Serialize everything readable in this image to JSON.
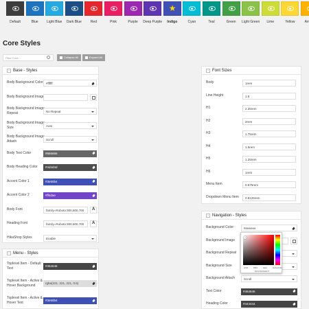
{
  "swatches": [
    {
      "name": "Default",
      "color": "#3d3d3d",
      "icon": "eye-icon"
    },
    {
      "name": "Blue",
      "color": "#1e73be",
      "icon": "eye-icon"
    },
    {
      "name": "Light Blue",
      "color": "#25a9e0",
      "icon": "eye-icon"
    },
    {
      "name": "Dark Blue",
      "color": "#1b4e84",
      "icon": "eye-icon"
    },
    {
      "name": "Red",
      "color": "#e5262d",
      "icon": "eye-icon"
    },
    {
      "name": "Pink",
      "color": "#e91e63",
      "icon": "eye-icon"
    },
    {
      "name": "Purple",
      "color": "#9c27b0",
      "icon": "eye-icon"
    },
    {
      "name": "Deep Purple",
      "color": "#5e35b1",
      "icon": "eye-icon"
    },
    {
      "name": "Indigo",
      "color": "#3f51b5",
      "icon": "star-icon",
      "active": true
    },
    {
      "name": "Cyan",
      "color": "#00bcd4",
      "icon": "eye-icon"
    },
    {
      "name": "Teal",
      "color": "#009688",
      "icon": "eye-icon"
    },
    {
      "name": "Green",
      "color": "#43a047",
      "icon": "eye-icon"
    },
    {
      "name": "Light Green",
      "color": "#8bc34a",
      "icon": "eye-icon"
    },
    {
      "name": "Lime",
      "color": "#cddc39",
      "icon": "eye-icon"
    },
    {
      "name": "Yellow",
      "color": "#fdd835",
      "icon": "eye-icon"
    },
    {
      "name": "Amber",
      "color": "#ffb300",
      "icon": "eye-icon"
    }
  ],
  "page_title": "Core Styles",
  "filter": {
    "placeholder": "Filter Core...",
    "collapse_label": "Collapse All",
    "expand_label": "Expand All"
  },
  "base": {
    "title": "Base - Styles",
    "rows": [
      {
        "label": "Body Background Color",
        "type": "color",
        "value": "#ffffff"
      },
      {
        "label": "Body Background Image",
        "type": "image",
        "value": ""
      },
      {
        "label": "Body Background Image Repeat",
        "type": "select",
        "value": "No Repeat"
      },
      {
        "label": "Body Background Image Size",
        "type": "select",
        "value": "Auto"
      },
      {
        "label": "Body Background Image Attach",
        "type": "select",
        "value": "Scroll"
      },
      {
        "label": "Body Text Color",
        "type": "color",
        "value": "#666666",
        "bg": "#666666"
      },
      {
        "label": "Body Heading Color",
        "type": "color",
        "value": "#4d4d4d",
        "bg": "#4d4d4d"
      },
      {
        "label": "Accent Color 1",
        "type": "color",
        "value": "#3e50b4",
        "bg": "#3e50b4"
      },
      {
        "label": "Accent Color 2",
        "type": "color",
        "value": "#ff4dae",
        "bg": "#7245c8"
      },
      {
        "label": "Body Font",
        "type": "font",
        "value": "family=Roboto:300,500,700"
      },
      {
        "label": "Heading Font",
        "type": "font",
        "value": "family=Roboto:300,500,700"
      },
      {
        "label": "HikaShop Styles",
        "type": "select",
        "value": "Enable"
      }
    ]
  },
  "menu": {
    "title": "Menu - Styles",
    "rows": [
      {
        "label": "Toplevel Item - Default Text",
        "type": "color",
        "value": "#464646",
        "bg": "#464646"
      },
      {
        "label": "Toplevel Item - Active & Hover Background",
        "type": "color",
        "value": "rgba(221, 221, 221, 0.6)",
        "bg": "#dddddd",
        "dark_text": true
      },
      {
        "label": "Toplevel Item - Active & Hover Text",
        "type": "color",
        "value": "#3e50b4",
        "bg": "#3e50b4"
      }
    ]
  },
  "fonts": {
    "title": "Font Sizes",
    "rows": [
      {
        "label": "Body",
        "value": "1rem"
      },
      {
        "label": "Line Height",
        "value": "1.5"
      },
      {
        "label": "H1",
        "value": "2.25rem"
      },
      {
        "label": "H2",
        "value": "2rem"
      },
      {
        "label": "H3",
        "value": "1.75rem"
      },
      {
        "label": "H4",
        "value": "1.5rem"
      },
      {
        "label": "H5",
        "value": "1.25rem"
      },
      {
        "label": "H6",
        "value": "1rem"
      },
      {
        "label": "Menu Item",
        "value": "0.875rem"
      },
      {
        "label": "Dropdown Menu Item",
        "value": "0.8125rem"
      }
    ]
  },
  "nav": {
    "title": "Navigation - Styles",
    "rows": [
      {
        "label": "Background Color",
        "type": "color",
        "value": "#eeeeee"
      },
      {
        "label": "Background Image",
        "type": "image",
        "value": ""
      },
      {
        "label": "Background Repeat",
        "type": "select",
        "value": ""
      },
      {
        "label": "Background Size",
        "type": "select",
        "value": ""
      },
      {
        "label": "Background Attach",
        "type": "select",
        "value": "Scroll"
      },
      {
        "label": "Text Color",
        "type": "color",
        "value": "#464646",
        "bg": "#464646"
      },
      {
        "label": "Heading Color",
        "type": "color",
        "value": "#444444",
        "bg": "#444444"
      }
    ]
  },
  "picker": {
    "modes": [
      "HSB",
      "RBG",
      "HEX",
      "RANDOM"
    ],
    "transparent_label": "TRANSPARENT"
  }
}
